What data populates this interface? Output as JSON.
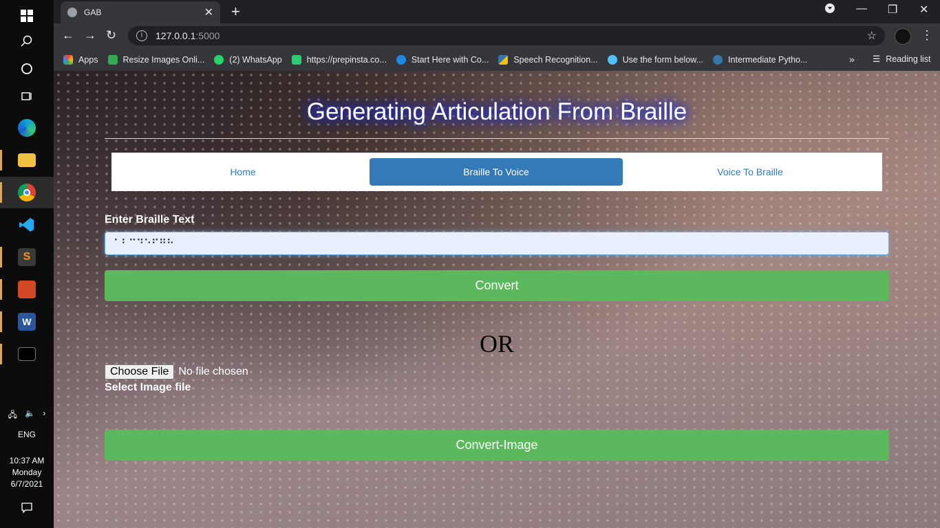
{
  "taskbar": {
    "language": "ENG",
    "time": "10:37 AM",
    "day": "Monday",
    "date": "6/7/2021"
  },
  "browser": {
    "tab_title": "GAB",
    "url_host": "127.0.0.1",
    "url_port": ":5000",
    "bookmarks": [
      {
        "label": "Apps",
        "color": "#ea4335"
      },
      {
        "label": "Resize Images Onli...",
        "color": "#34a853"
      },
      {
        "label": "(2) WhatsApp",
        "color": "#25d366"
      },
      {
        "label": "https://prepinsta.co...",
        "color": "#2ecc71"
      },
      {
        "label": "Start Here with Co...",
        "color": "#1e88e5"
      },
      {
        "label": "Speech Recognition...",
        "color": "#f4c20d"
      },
      {
        "label": "Use the form below...",
        "color": "#4fc3f7"
      },
      {
        "label": "Intermediate Pytho...",
        "color": "#3776ab"
      }
    ],
    "reading_list": "Reading list"
  },
  "page": {
    "heading": "Generating Articulation From Braille",
    "nav": {
      "home": "Home",
      "braille_to_voice": "Braille To Voice",
      "voice_to_braille": "Voice To Braille"
    },
    "braille_label": "Enter Braille Text",
    "braille_value": "⠁⠃⠉⠙⠑⠋⠛⠓",
    "convert_label": "Convert",
    "or_text": "OR",
    "choose_file_label": "Choose File",
    "no_file_text": "No file chosen",
    "select_image_label": "Select Image file",
    "convert_image_label": "Convert-Image"
  }
}
